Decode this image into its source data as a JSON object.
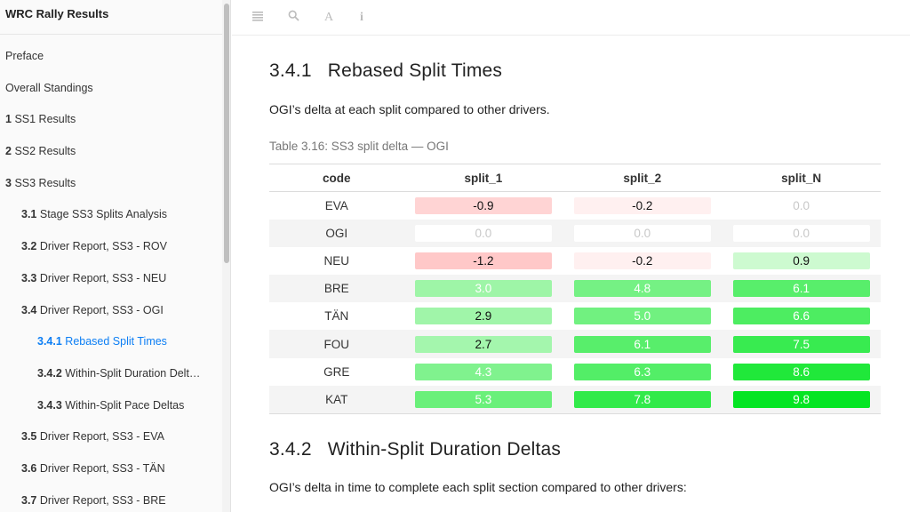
{
  "sidebar": {
    "title": "WRC Rally Results",
    "items": [
      {
        "num": "",
        "label": "Preface",
        "level": 0
      },
      {
        "num": "",
        "label": "Overall Standings",
        "level": 0
      },
      {
        "num": "1",
        "label": "SS1 Results",
        "level": 0
      },
      {
        "num": "2",
        "label": "SS2 Results",
        "level": 0
      },
      {
        "num": "3",
        "label": "SS3 Results",
        "level": 0
      },
      {
        "num": "3.1",
        "label": "Stage SS3 Splits Analysis",
        "level": 1
      },
      {
        "num": "3.2",
        "label": "Driver Report, SS3 - ROV",
        "level": 1
      },
      {
        "num": "3.3",
        "label": "Driver Report, SS3 - NEU",
        "level": 1
      },
      {
        "num": "3.4",
        "label": "Driver Report, SS3 - OGI",
        "level": 1
      },
      {
        "num": "3.4.1",
        "label": "Rebased Split Times",
        "level": 2,
        "active": true
      },
      {
        "num": "3.4.2",
        "label": "Within-Split Duration Delt…",
        "level": 2
      },
      {
        "num": "3.4.3",
        "label": "Within-Split Pace Deltas",
        "level": 2
      },
      {
        "num": "3.5",
        "label": "Driver Report, SS3 - EVA",
        "level": 1
      },
      {
        "num": "3.6",
        "label": "Driver Report, SS3 - TÄN",
        "level": 1
      },
      {
        "num": "3.7",
        "label": "Driver Report, SS3 - BRE",
        "level": 1
      }
    ]
  },
  "toolbar": {
    "icons": [
      "menu-icon",
      "search-icon",
      "font-icon",
      "info-icon"
    ]
  },
  "content": {
    "section1": {
      "num": "3.4.1",
      "title": "Rebased Split Times"
    },
    "section1_text": "OGI’s delta at each split compared to other drivers.",
    "table_caption": "Table 3.16: SS3 split delta — OGI",
    "table": {
      "headers": [
        "code",
        "split_1",
        "split_2",
        "split_N"
      ],
      "rows": [
        {
          "code": "EVA",
          "values": [
            "-0.9",
            "-0.2",
            "0.0"
          ]
        },
        {
          "code": "OGI",
          "values": [
            "0.0",
            "0.0",
            "0.0"
          ]
        },
        {
          "code": "NEU",
          "values": [
            "-1.2",
            "-0.2",
            "0.9"
          ]
        },
        {
          "code": "BRE",
          "values": [
            "3.0",
            "4.8",
            "6.1"
          ]
        },
        {
          "code": "TÄN",
          "values": [
            "2.9",
            "5.0",
            "6.6"
          ]
        },
        {
          "code": "FOU",
          "values": [
            "2.7",
            "6.1",
            "7.5"
          ]
        },
        {
          "code": "GRE",
          "values": [
            "4.3",
            "6.3",
            "8.6"
          ]
        },
        {
          "code": "KAT",
          "values": [
            "5.3",
            "7.8",
            "9.8"
          ]
        }
      ]
    },
    "section2": {
      "num": "3.4.2",
      "title": "Within-Split Duration Deltas"
    },
    "section2_text": "OGI’s delta in time to complete each split section compared to other drivers:"
  },
  "colors": {
    "accent": "#0c7ef4",
    "positive": "#00e51f",
    "negative": "#ff9b9b"
  }
}
